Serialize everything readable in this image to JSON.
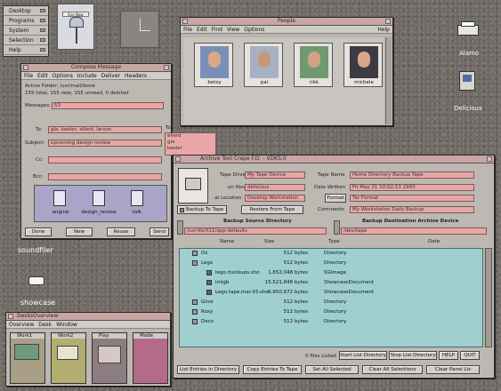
{
  "desktop_menu": [
    "Desktop",
    "Programs",
    "System",
    "Selection",
    "Help"
  ],
  "desktop_icons": {
    "mailbox_label": "",
    "soundfiler_label": "soundfiler",
    "showcase_label": "showcase",
    "printer_label": "Alamo",
    "computer_label": "Delicious"
  },
  "people": {
    "title": "People",
    "menu": [
      "File",
      "Edit",
      "Find",
      "View",
      "Options"
    ],
    "help": "Help",
    "row1": [
      "betsy",
      "pal",
      "rikk",
      "michele"
    ]
  },
  "compose": {
    "title": "Compose Message",
    "menu": [
      "File",
      "Edit",
      "Options",
      "Include",
      "Deliver",
      "Headers"
    ],
    "folder_line": "Active Folder: /usr/mail/bove",
    "summary_line": "155 total, 155 new, 155 unread, 0 deleted",
    "messages_label": "Messages:",
    "messages_value": "53",
    "to_label": "To:",
    "to_value": "gla, keeler, ellerd, larson",
    "subject_label": "Subject:",
    "subject_value": "upcoming design review",
    "cc_label": "Cc:",
    "bcc_label": "Bcc:",
    "to_side_label": "To:",
    "to_side_list": [
      "ellerd",
      "gla",
      "keeler"
    ],
    "attachments": [
      "engine",
      "design_review",
      "talk"
    ],
    "buttons": [
      "Done",
      "New",
      "Reuse",
      "Send"
    ]
  },
  "archive": {
    "title": "Archive Tool Crepe F.D. - VDKS.0",
    "tape_drive_label": "Tape Drive",
    "tape_drive_value": "My Tape Device",
    "on_host_label": "on Host",
    "on_host_value": "delicious",
    "at_location_label": "at Location",
    "at_location_value": "Desktop Workstation",
    "tape_name_label": "Tape Name",
    "tape_name_value": "Home Directory Backup Tape",
    "date_written_label": "Date Written",
    "date_written_value": "Fri May 21 10:02:13 1993",
    "format_label": "Format",
    "format_value": "Tar Format",
    "comments_label": "Comments",
    "comments_value": "My Workstation Daily Backup",
    "backup_to_tape": "Backup To Tape",
    "restore_from_tape": "Restore From Tape",
    "source_header": "Backup Source Directory",
    "source_value": "/usr/lib/X11/app-defaults",
    "dest_header": "Backup Destination Archive Device",
    "dest_value": "/dev/tape",
    "columns": [
      "Name",
      "Size",
      "Type",
      "Date"
    ],
    "files": [
      {
        "name": "Oz",
        "size": "512 bytes",
        "type": "Directory",
        "indent": 0
      },
      {
        "name": "Lego",
        "size": "512 bytes",
        "type": "Directory",
        "indent": 0
      },
      {
        "name": "lego.mockups.sho",
        "size": "1,652,048 bytes",
        "type": "SGImage",
        "indent": 1
      },
      {
        "name": "imlgb",
        "size": "15,521,848 bytes",
        "type": "ShowcaseDocument",
        "indent": 1
      },
      {
        "name": "Lego.tape.mar.93.sho",
        "size": "6,650,672 bytes",
        "type": "ShowcaseDocument",
        "indent": 1
      },
      {
        "name": "Ginsi",
        "size": "512 bytes",
        "type": "Directory",
        "indent": 0
      },
      {
        "name": "Roxy",
        "size": "512 bytes",
        "type": "Directory",
        "indent": 0
      },
      {
        "name": "Deco",
        "size": "512 bytes",
        "type": "Directory",
        "indent": 0
      }
    ],
    "files_listed": "0 files Listed",
    "start_list": "Start List Directory",
    "stop_list": "Stop List Directory",
    "help": "HELP",
    "quit": "QUIT",
    "bottom_buttons": [
      "List Entries in Directory",
      "Copy Entries To Tape",
      "Set All Selected",
      "Clear All Selections",
      "Clear Panel Lis"
    ]
  },
  "desks": {
    "title": "DesksOverview",
    "menu": [
      "Overview",
      "Desk",
      "Window"
    ],
    "desks": [
      "Work1",
      "Work2",
      "Play",
      "Mode"
    ]
  }
}
